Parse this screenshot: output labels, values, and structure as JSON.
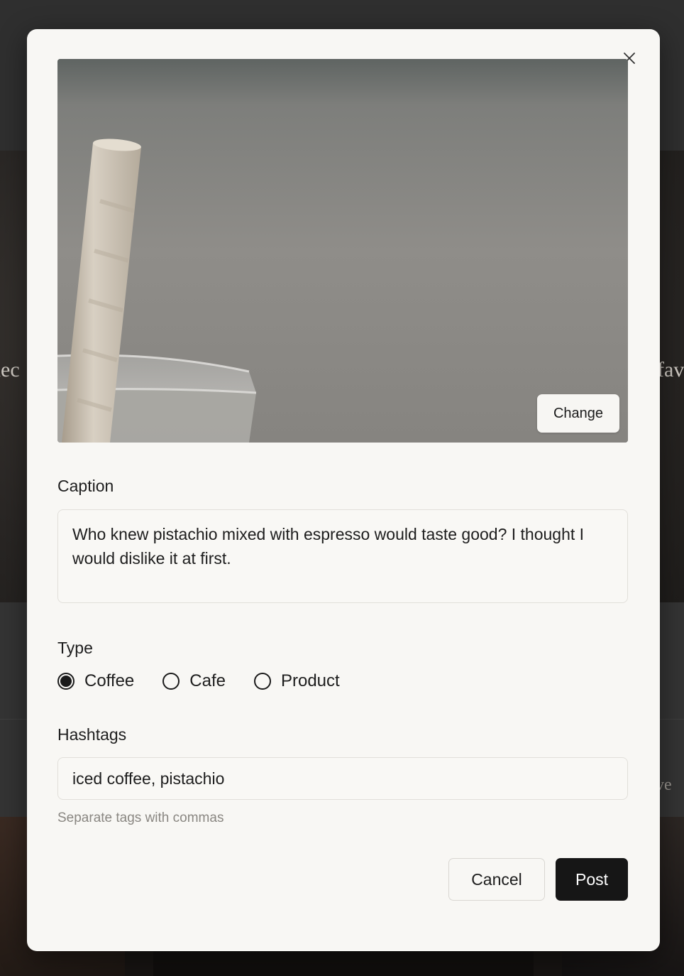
{
  "background": {
    "left_word": "nec",
    "right_word": "fav",
    "bottom_right_word": "ve"
  },
  "modal": {
    "close_icon": "close-icon",
    "photo": {
      "description_icon": "photo-preview",
      "change_label": "Change"
    },
    "caption": {
      "label": "Caption",
      "value": "Who knew pistachio mixed with espresso would taste good? I thought I would dislike it at first."
    },
    "type": {
      "label": "Type",
      "options": [
        {
          "label": "Coffee",
          "selected": true
        },
        {
          "label": "Cafe",
          "selected": false
        },
        {
          "label": "Product",
          "selected": false
        }
      ]
    },
    "hashtags": {
      "label": "Hashtags",
      "value": "iced coffee, pistachio",
      "helper": "Separate tags with commas"
    },
    "actions": {
      "cancel_label": "Cancel",
      "post_label": "Post"
    }
  }
}
